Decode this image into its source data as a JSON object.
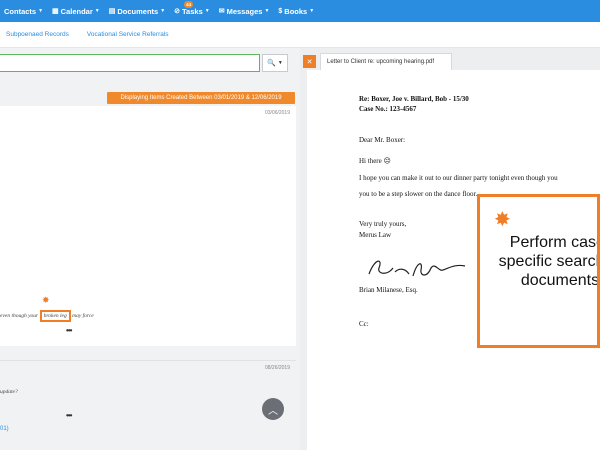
{
  "nav": {
    "items": [
      {
        "label": "Contacts",
        "icon": "contacts-icon"
      },
      {
        "label": "Calendar",
        "icon": "calendar-icon"
      },
      {
        "label": "Documents",
        "icon": "documents-icon"
      },
      {
        "label": "Tasks",
        "icon": "tasks-icon",
        "badge": "44"
      },
      {
        "label": "Messages",
        "icon": "envelope-icon"
      },
      {
        "label": "Books",
        "icon": "dollar-icon"
      }
    ]
  },
  "subnav": {
    "links": [
      "Subpoenaed Records",
      "Vocational Service Referrals"
    ]
  },
  "search": {
    "value": "",
    "button_icon": "search-icon"
  },
  "results": {
    "filter_badge": "Displaying Items Created Between 03/01/2019 & 12/06/2019",
    "card1": {
      "date": "03/06/2019",
      "snippet_before": "even though your",
      "highlight": "broken  leg",
      "snippet_after": "may force",
      "more": "•••"
    },
    "card2": {
      "date": "08/26/2019",
      "text": "update?",
      "more": "•••",
      "link": "01)"
    }
  },
  "document": {
    "tab_title": "Letter to Client re: upcoming hearing.pdf",
    "re_line": "Re: Boxer, Joe v. Billard, Bob - 15/30",
    "case_line": "Case No.:  123-4567",
    "salutation": "Dear Mr. Boxer:",
    "greeting": "Hi there ☹",
    "body1": "I hope you can make it out to our dinner party tonight even though you",
    "body2": "you to be a step slower on the dance floor.",
    "closing": "Very truly yours,",
    "firm": "Merus Law",
    "signer": "Brian Milanese, Esq.",
    "cc": "Cc:"
  },
  "callout": {
    "text": "Perform case-specific searches documents"
  },
  "colors": {
    "nav_blue": "#2a8de0",
    "accent_orange": "#f07e26"
  }
}
